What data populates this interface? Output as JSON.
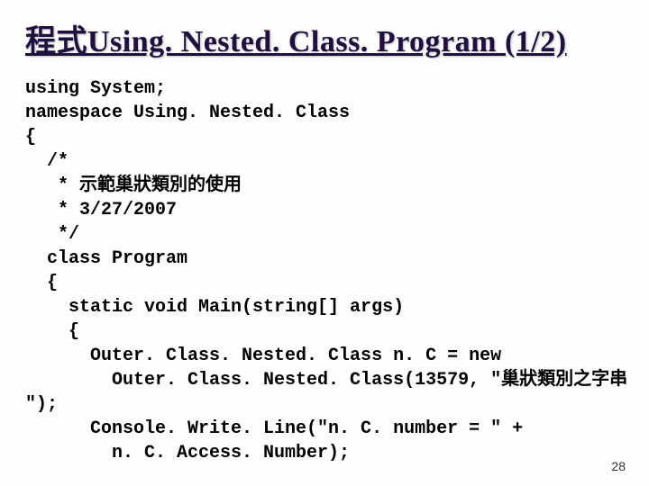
{
  "title": "程式Using. Nested. Class. Program (1/2)",
  "code_lines": [
    "using System;",
    "namespace Using. Nested. Class",
    "{",
    "  /*",
    "   * 示範巢狀類別的使用",
    "   * 3/27/2007",
    "   */",
    "  class Program",
    "  {",
    "    static void Main(string[] args)",
    "    {",
    "      Outer. Class. Nested. Class n. C = new",
    "        Outer. Class. Nested. Class(13579, \"巢狀類別之字串",
    "\");",
    "      Console. Write. Line(\"n. C. number = \" +",
    "        n. C. Access. Number);"
  ],
  "page_number": "28"
}
